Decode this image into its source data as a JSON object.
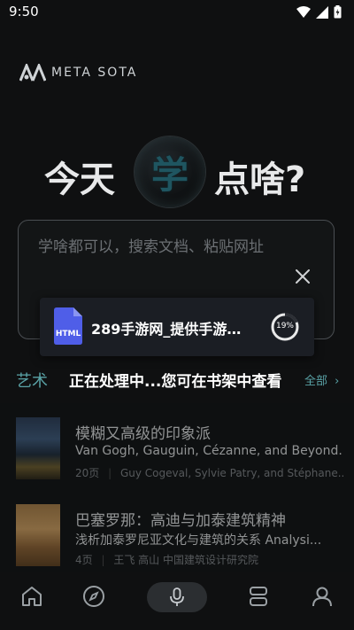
{
  "status_bar": {
    "time": "9:50"
  },
  "logo": {
    "text": "META SOTA"
  },
  "headline": {
    "left": "今天",
    "highlight": "学",
    "right": "点啥?"
  },
  "search": {
    "placeholder": "学啥都可以，搜索文档、粘贴网址"
  },
  "processing_card": {
    "file_type": "HTML",
    "title": "289手游网_提供手游…",
    "progress_label": "19%",
    "progress_value": 0.19
  },
  "category": {
    "label": "艺术",
    "processing_message": "正在处理中...您可在书架中查看",
    "see_all": "全部",
    "accent_color": "#5aa3a7"
  },
  "books": [
    {
      "title": "模糊又高级的印象派",
      "subtitle": "Van Gogh, Gauguin, Cézanne, and Beyond...",
      "pages": "20页",
      "authors": "Guy Cogeval, Sylvie Patry, and Stéphane..."
    },
    {
      "title": "巴塞罗那：高迪与加泰建筑精神",
      "subtitle": "浅析加泰罗尼亚文化与建筑的关系 Analysi...",
      "pages": "4页",
      "authors": "王飞 高山 中国建筑设计研究院"
    }
  ],
  "bottom_nav": {
    "items": [
      "home-icon",
      "compass-icon",
      "mic-icon",
      "shelf-icon",
      "profile-icon"
    ]
  }
}
